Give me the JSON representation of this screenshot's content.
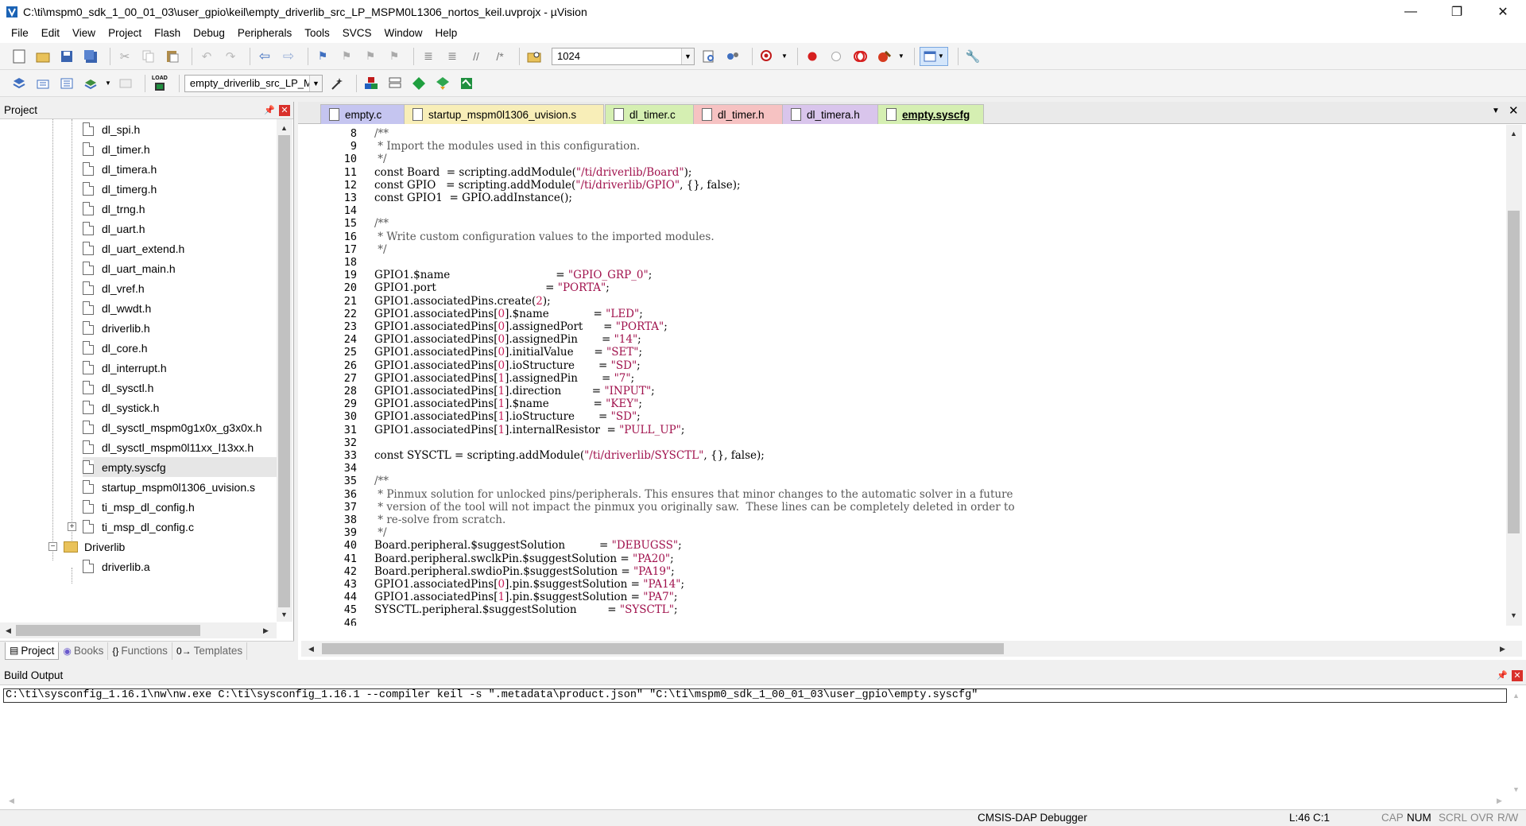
{
  "window": {
    "title": "C:\\ti\\mspm0_sdk_1_00_01_03\\user_gpio\\keil\\empty_driverlib_src_LP_MSPM0L1306_nortos_keil.uvprojx - µVision",
    "minimize": "—",
    "maximize": "❐",
    "close": "✕"
  },
  "menu": [
    "File",
    "Edit",
    "View",
    "Project",
    "Flash",
    "Debug",
    "Peripherals",
    "Tools",
    "SVCS",
    "Window",
    "Help"
  ],
  "toolbar1": {
    "find_value": "1024"
  },
  "toolbar2": {
    "target_value": "empty_driverlib_src_LP_M",
    "load_label": "LOAD"
  },
  "project_pane": {
    "title": "Project",
    "tree": [
      "dl_spi.h",
      "dl_timer.h",
      "dl_timera.h",
      "dl_timerg.h",
      "dl_trng.h",
      "dl_uart.h",
      "dl_uart_extend.h",
      "dl_uart_main.h",
      "dl_vref.h",
      "dl_wwdt.h",
      "driverlib.h",
      "dl_core.h",
      "dl_interrupt.h",
      "dl_sysctl.h",
      "dl_systick.h",
      "dl_sysctl_mspm0g1x0x_g3x0x.h",
      "dl_sysctl_mspm0l11xx_l13xx.h",
      "empty.syscfg",
      "startup_mspm0l1306_uvision.s",
      "ti_msp_dl_config.h",
      "ti_msp_dl_config.c"
    ],
    "group_name": "Driverlib",
    "group_child": "driverlib.a",
    "expander_plus": "+",
    "expander_minus": "−",
    "tabs": [
      "Project",
      "Books",
      "Functions",
      "Templates"
    ],
    "tab_icons": [
      "▤",
      "◉",
      "{}",
      "0→"
    ]
  },
  "editor": {
    "tabs": [
      {
        "label": "empty.c",
        "color": "#c5c5f0"
      },
      {
        "label": "startup_mspm0l1306_uvision.s",
        "color": "#f8eeb8"
      },
      {
        "label": "dl_timer.c",
        "color": "#d5efb2"
      },
      {
        "label": "dl_timer.h",
        "color": "#f6c2c2"
      },
      {
        "label": "dl_timera.h",
        "color": "#d9c5ec"
      },
      {
        "label": "empty.syscfg",
        "color": "#d5efb2",
        "active": true
      }
    ],
    "first_line": 8,
    "lines": [
      "/**",
      " * Import the modules used in this configuration.",
      " */",
      "const Board  = scripting.addModule(\"/ti/driverlib/Board\");",
      "const GPIO   = scripting.addModule(\"/ti/driverlib/GPIO\", {}, false);",
      "const GPIO1  = GPIO.addInstance();",
      "",
      "/**",
      " * Write custom configuration values to the imported modules.",
      " */",
      "",
      "GPIO1.$name                               = \"GPIO_GRP_0\";",
      "GPIO1.port                                = \"PORTA\";",
      "GPIO1.associatedPins.create(2);",
      "GPIO1.associatedPins[0].$name             = \"LED\";",
      "GPIO1.associatedPins[0].assignedPort      = \"PORTA\";",
      "GPIO1.associatedPins[0].assignedPin       = \"14\";",
      "GPIO1.associatedPins[0].initialValue      = \"SET\";",
      "GPIO1.associatedPins[0].ioStructure       = \"SD\";",
      "GPIO1.associatedPins[1].assignedPin       = \"7\";",
      "GPIO1.associatedPins[1].direction         = \"INPUT\";",
      "GPIO1.associatedPins[1].$name             = \"KEY\";",
      "GPIO1.associatedPins[1].ioStructure       = \"SD\";",
      "GPIO1.associatedPins[1].internalResistor  = \"PULL_UP\";",
      "",
      "const SYSCTL = scripting.addModule(\"/ti/driverlib/SYSCTL\", {}, false);",
      "",
      "/**",
      " * Pinmux solution for unlocked pins/peripherals. This ensures that minor changes to the automatic solver in a future",
      " * version of the tool will not impact the pinmux you originally saw.  These lines can be completely deleted in order to",
      " * re-solve from scratch.",
      " */",
      "Board.peripheral.$suggestSolution          = \"DEBUGSS\";",
      "Board.peripheral.swclkPin.$suggestSolution = \"PA20\";",
      "Board.peripheral.swdioPin.$suggestSolution = \"PA19\";",
      "GPIO1.associatedPins[0].pin.$suggestSolution = \"PA14\";",
      "GPIO1.associatedPins[1].pin.$suggestSolution = \"PA7\";",
      "SYSCTL.peripheral.$suggestSolution         = \"SYSCTL\";",
      ""
    ]
  },
  "build": {
    "title": "Build Output",
    "text": "C:\\ti\\sysconfig_1.16.1\\nw\\nw.exe C:\\ti\\sysconfig_1.16.1 --compiler keil -s \".metadata\\product.json\" \"C:\\ti\\mspm0_sdk_1_00_01_03\\user_gpio\\empty.syscfg\""
  },
  "status": {
    "debugger": "CMSIS-DAP Debugger",
    "position": "L:46 C:1",
    "cap": "CAP",
    "num": "NUM",
    "scrl": "SCRL",
    "ovr": "OVR",
    "rw": "R/W"
  },
  "colors": {
    "accent_blue": "#3f6fc0",
    "close_red": "#d9302b",
    "string": "#a0114c",
    "comment": "#585858"
  }
}
